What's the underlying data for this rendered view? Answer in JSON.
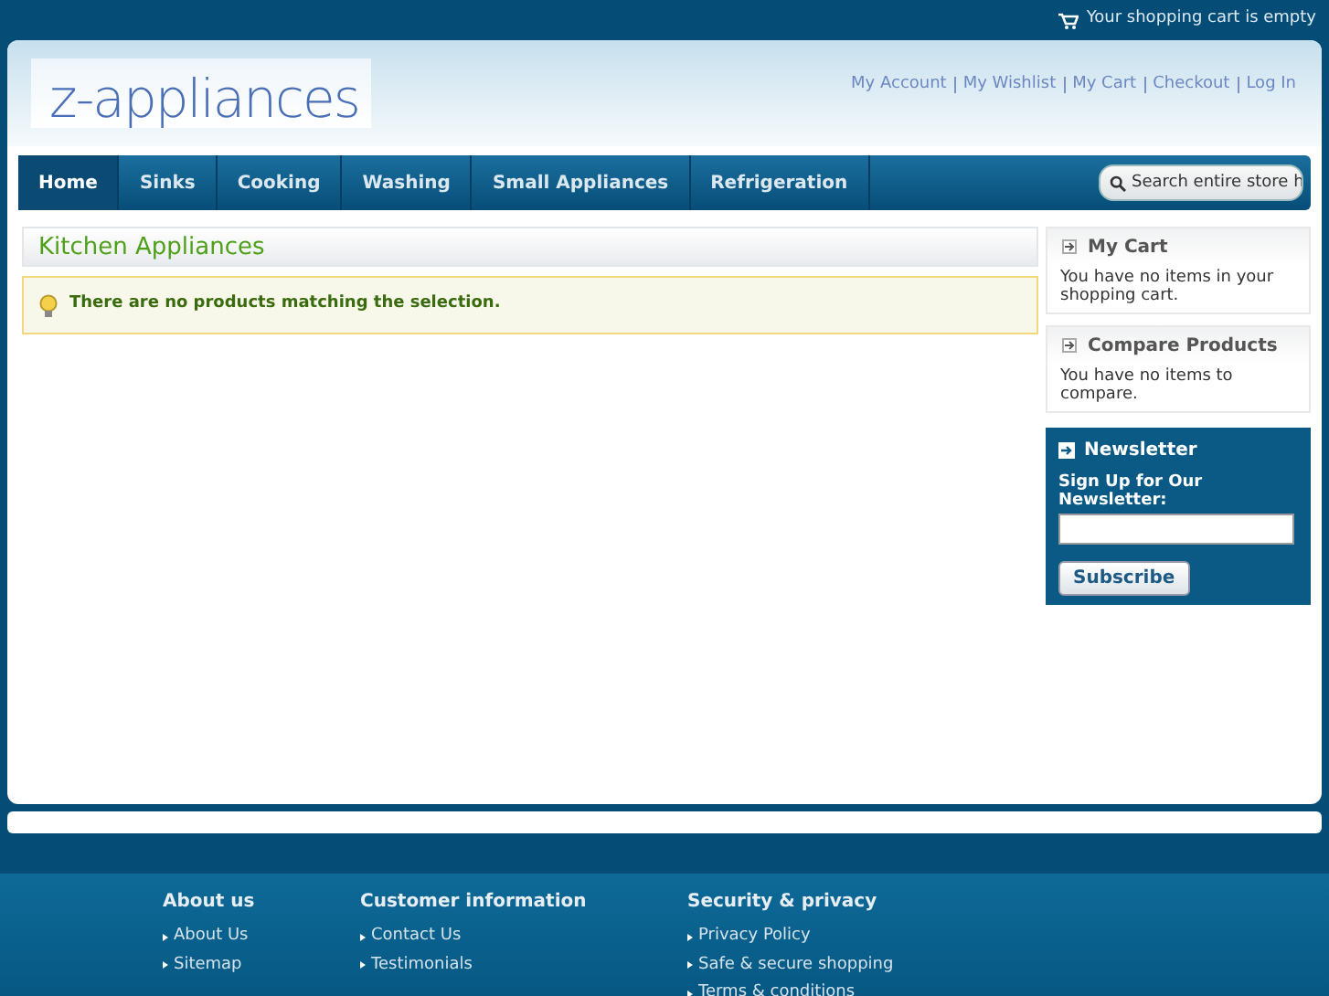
{
  "top_bar": {
    "cart_status": "Your shopping cart is empty"
  },
  "header": {
    "logo": "z-appliances",
    "links": [
      "My Account",
      "My Wishlist",
      "My Cart",
      "Checkout",
      "Log In"
    ]
  },
  "nav": {
    "items": [
      {
        "label": "Home",
        "selected": true
      },
      {
        "label": "Sinks",
        "selected": false
      },
      {
        "label": "Cooking",
        "selected": false
      },
      {
        "label": "Washing",
        "selected": false
      },
      {
        "label": "Small Appliances",
        "selected": false
      },
      {
        "label": "Refrigeration",
        "selected": false
      }
    ],
    "search": {
      "placeholder": "Search entire store h"
    }
  },
  "main": {
    "title": "Kitchen Appliances",
    "notice": "There are no products matching the selection."
  },
  "sidebar": {
    "blocks": [
      {
        "title": "My Cart",
        "text": "You have no items in your shopping cart."
      },
      {
        "title": "Compare Products",
        "text": "You have no items to compare."
      }
    ],
    "newsletter": {
      "title": "Newsletter",
      "label": "Sign Up for Our Newsletter:",
      "button": "Subscribe"
    }
  },
  "footer": {
    "columns": [
      {
        "title": "About us",
        "links": [
          "About Us",
          "Sitemap"
        ]
      },
      {
        "title": "Customer information",
        "links": [
          "Contact Us",
          "Testimonials"
        ]
      },
      {
        "title": "Security & privacy",
        "links": [
          "Privacy Policy",
          "Safe & secure shopping",
          "Terms & conditions"
        ]
      }
    ]
  }
}
